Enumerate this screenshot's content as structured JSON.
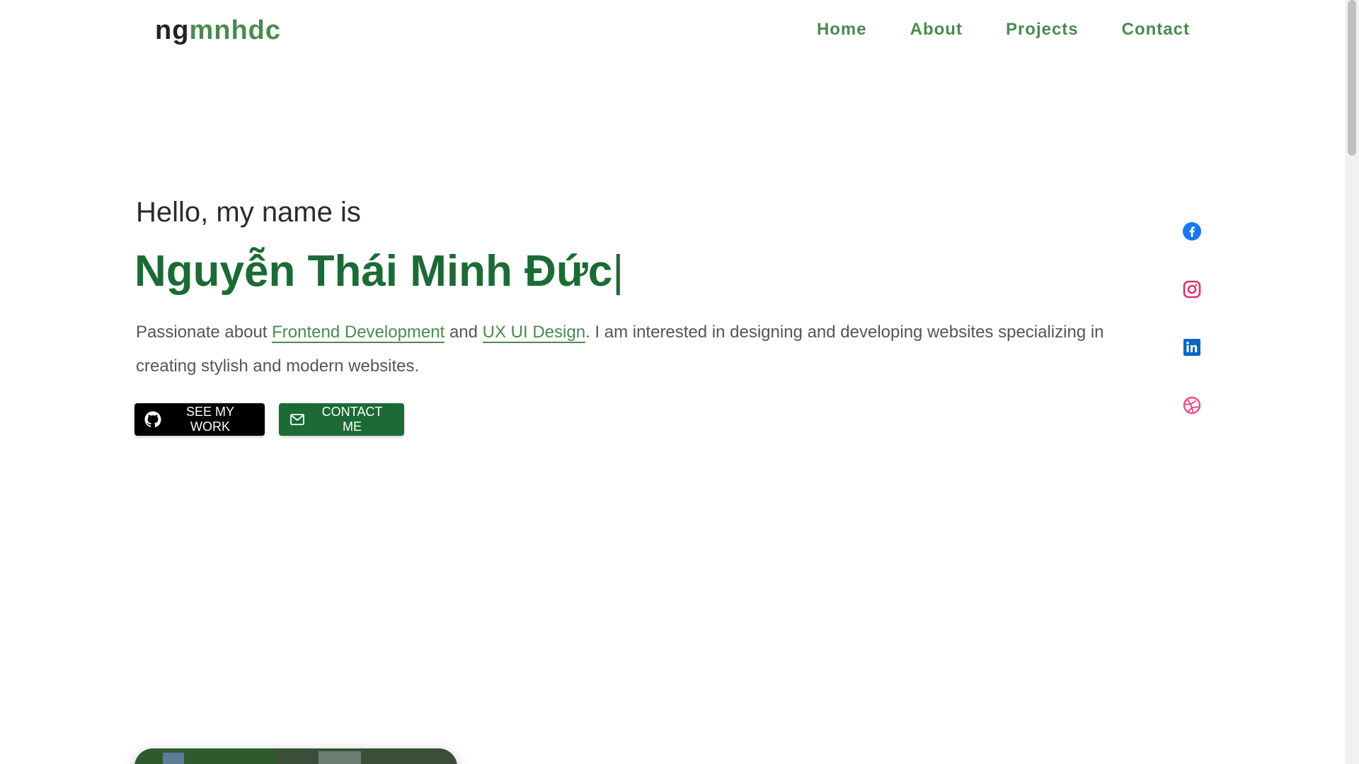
{
  "logo": {
    "part1": "ng",
    "part2": "mnhdc"
  },
  "nav": {
    "items": [
      {
        "label": "Home"
      },
      {
        "label": "About"
      },
      {
        "label": "Projects"
      },
      {
        "label": "Contact"
      }
    ]
  },
  "hero": {
    "greeting": "Hello, my name is",
    "name": "Nguyễn Thái Minh Đức",
    "cursor": "|",
    "description": {
      "before": "Passionate about ",
      "link1": "Frontend Development",
      "middle": " and ",
      "link2": "UX UI Design",
      "after": ". I am interested in designing and developing websites specializing in creating stylish and modern websites."
    },
    "buttons": {
      "see_work": "SEE MY WORK",
      "contact": "CONTACT ME"
    }
  },
  "social": {
    "items": [
      {
        "icon": "facebook-icon",
        "color": "#1877f2"
      },
      {
        "icon": "instagram-icon",
        "color": "#e1306c"
      },
      {
        "icon": "linkedin-icon",
        "color": "#0a66c2"
      },
      {
        "icon": "dribbble-icon",
        "color": "#ea4c89"
      }
    ]
  },
  "colors": {
    "brand_green": "#4a8a4f",
    "name_green": "#1c6a35",
    "button_dark": "#000000"
  }
}
